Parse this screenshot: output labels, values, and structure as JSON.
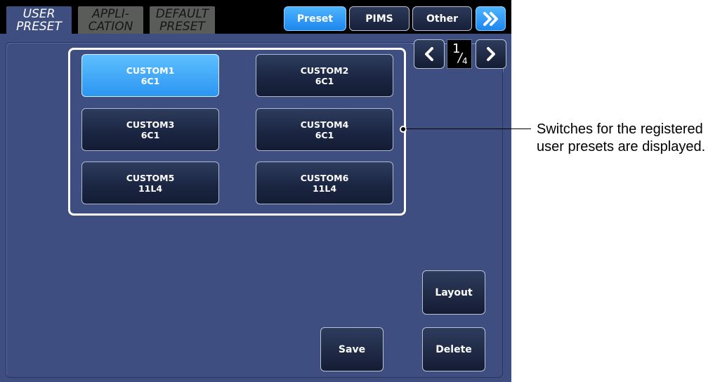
{
  "tabs": [
    {
      "line1": "USER",
      "line2": "PRESET"
    },
    {
      "line1": "APPLI-",
      "line2": "CATION"
    },
    {
      "line1": "DEFAULT",
      "line2": "PRESET"
    }
  ],
  "top_buttons": {
    "preset": "Preset",
    "pims": "PIMS",
    "other": "Other",
    "more_icon": "»"
  },
  "custom_buttons": [
    {
      "name": "CUSTOM1",
      "value": "6C1"
    },
    {
      "name": "CUSTOM2",
      "value": "6C1"
    },
    {
      "name": "CUSTOM3",
      "value": "6C1"
    },
    {
      "name": "CUSTOM4",
      "value": "6C1"
    },
    {
      "name": "CUSTOM5",
      "value": "11L4"
    },
    {
      "name": "CUSTOM6",
      "value": "11L4"
    }
  ],
  "pager": {
    "prev_icon": "❮",
    "next_icon": "❯",
    "current": "1",
    "total": "4"
  },
  "actions": {
    "layout": "Layout",
    "save": "Save",
    "delete": "Delete"
  },
  "annotation": {
    "text": "Switches for the registered user presets are displayed."
  },
  "colors": {
    "accent": "#2b95f2",
    "panel_bg": "#3f4e80",
    "button_bg": "#1b2643"
  }
}
